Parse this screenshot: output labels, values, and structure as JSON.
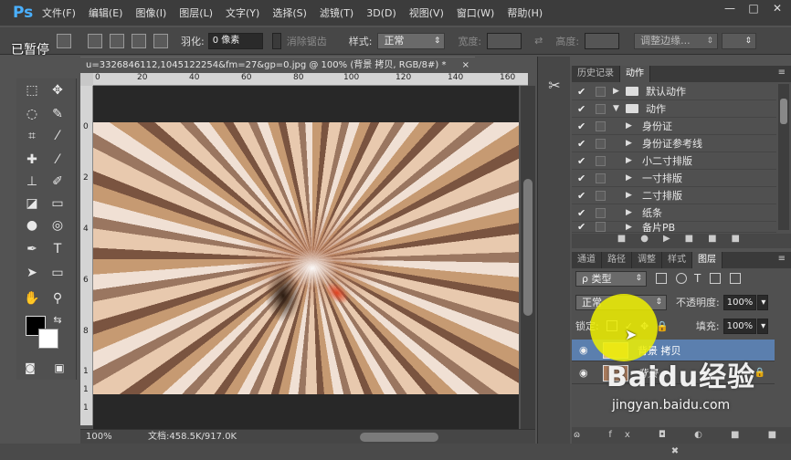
{
  "app": {
    "logo": "Ps",
    "paused_overlay": "已暂停"
  },
  "menu": [
    "文件(F)",
    "编辑(E)",
    "图像(I)",
    "图层(L)",
    "文字(Y)",
    "选择(S)",
    "滤镜(T)",
    "3D(D)",
    "视图(V)",
    "窗口(W)",
    "帮助(H)"
  ],
  "window_controls": [
    "—",
    "□",
    "✕"
  ],
  "options": {
    "feather_label": "羽化:",
    "feather_value": "0 像素",
    "antialias_label": "消除锯齿",
    "style_label": "样式:",
    "style_value": "正常",
    "width_label": "宽度:",
    "height_label": "高度:",
    "refine_button": "调整边缘..."
  },
  "document": {
    "tab_title": "u=3326846112,1045122254&fm=27&gp=0.jpg @ 100% (背景 拷贝, RGB/8#) *",
    "close": "×",
    "ruler_h": [
      "0",
      "20",
      "40",
      "60",
      "80",
      "100",
      "120",
      "140",
      "160"
    ],
    "ruler_v": [
      "0",
      "2",
      "4",
      "6",
      "8",
      "1",
      "1",
      "1"
    ],
    "zoom": "100%",
    "doc_info": "文档:458.5K/917.0K"
  },
  "actions_panel": {
    "tabs": [
      "历史记录",
      "动作"
    ],
    "active_tab": 1,
    "rows": [
      {
        "label": "默认动作",
        "type": "set",
        "open": false
      },
      {
        "label": "动作",
        "type": "set",
        "open": true
      },
      {
        "label": "身份证",
        "type": "action"
      },
      {
        "label": "身份证参考线",
        "type": "action"
      },
      {
        "label": "小二寸排版",
        "type": "action"
      },
      {
        "label": "一寸排版",
        "type": "action"
      },
      {
        "label": "二寸排版",
        "type": "action"
      },
      {
        "label": "纸条",
        "type": "action"
      },
      {
        "label": "备片PB",
        "type": "action"
      }
    ],
    "footer_icons": "■●▶■■■"
  },
  "layers_panel": {
    "tabs": [
      "通道",
      "路径",
      "调整",
      "样式",
      "图层"
    ],
    "active_tab": 4,
    "filter": "ρ 类型",
    "blend_mode": "正常",
    "opacity_label": "不透明度:",
    "opacity_value": "100%",
    "lock_label": "锁定:",
    "fill_label": "填充:",
    "fill_value": "100%",
    "layers": [
      {
        "name": "背景 拷贝",
        "selected": true
      },
      {
        "name": "背景",
        "selected": false
      }
    ],
    "footer_icons": "ɷ fx ◘ ◐ ■ ■ ✖"
  },
  "watermark": {
    "brand": "Baidu经验",
    "url": "jingyan.baidu.com"
  },
  "colors": {
    "accent": "#4ab0ff",
    "selected_layer": "#5b7fae",
    "cursor_highlight": "#eef000"
  }
}
